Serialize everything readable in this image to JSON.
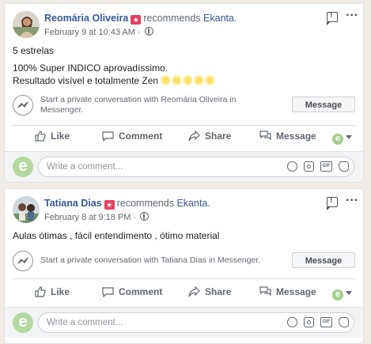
{
  "posts": [
    {
      "author": "Reomária Oliveira",
      "recommends_text": "recommends",
      "page_name": "Ekanta.",
      "timestamp": "February 9 at 10:43 AM ·",
      "body_lines": [
        "5 estrelas",
        "100% Super INDICO aprovadíssimo.",
        "Resultado visível e totalmente Zen"
      ],
      "messenger_prompt": "Start a private conversation with Reomária Oliveira in Messenger.",
      "message_button": "Message"
    },
    {
      "author": "Tatiana Dias",
      "recommends_text": "recommends",
      "page_name": "Ekanta.",
      "timestamp": "February 8 at 9:18 PM ·",
      "body_lines": [
        "Aulas ótimas , fácil entendimento , ótimo material"
      ],
      "messenger_prompt": "Start a private conversation with Tatiana Dias in Messenger.",
      "message_button": "Message"
    }
  ],
  "actions": {
    "like": "Like",
    "comment": "Comment",
    "share": "Share",
    "message": "Message"
  },
  "comment_box": {
    "placeholder": "Write a comment...",
    "gif_label": "GIF",
    "avatar_letter": "e"
  },
  "icons": {
    "recommend": "recommend-star-icon",
    "globe": "globe-icon",
    "flag": "report-flag-icon",
    "more": "more-options-icon",
    "messenger": "messenger-icon",
    "like": "thumbs-up-icon",
    "comment": "comment-bubble-icon",
    "share": "share-arrow-icon",
    "message": "message-bubbles-icon",
    "emoji": "emoji-icon",
    "camera": "camera-icon",
    "gif": "gif-icon",
    "sticker": "sticker-icon"
  },
  "colors": {
    "link": "#365899",
    "recommend_badge": "#e4405f",
    "page_avatar": "#b5d8a0",
    "background": "#f1ebe6"
  }
}
